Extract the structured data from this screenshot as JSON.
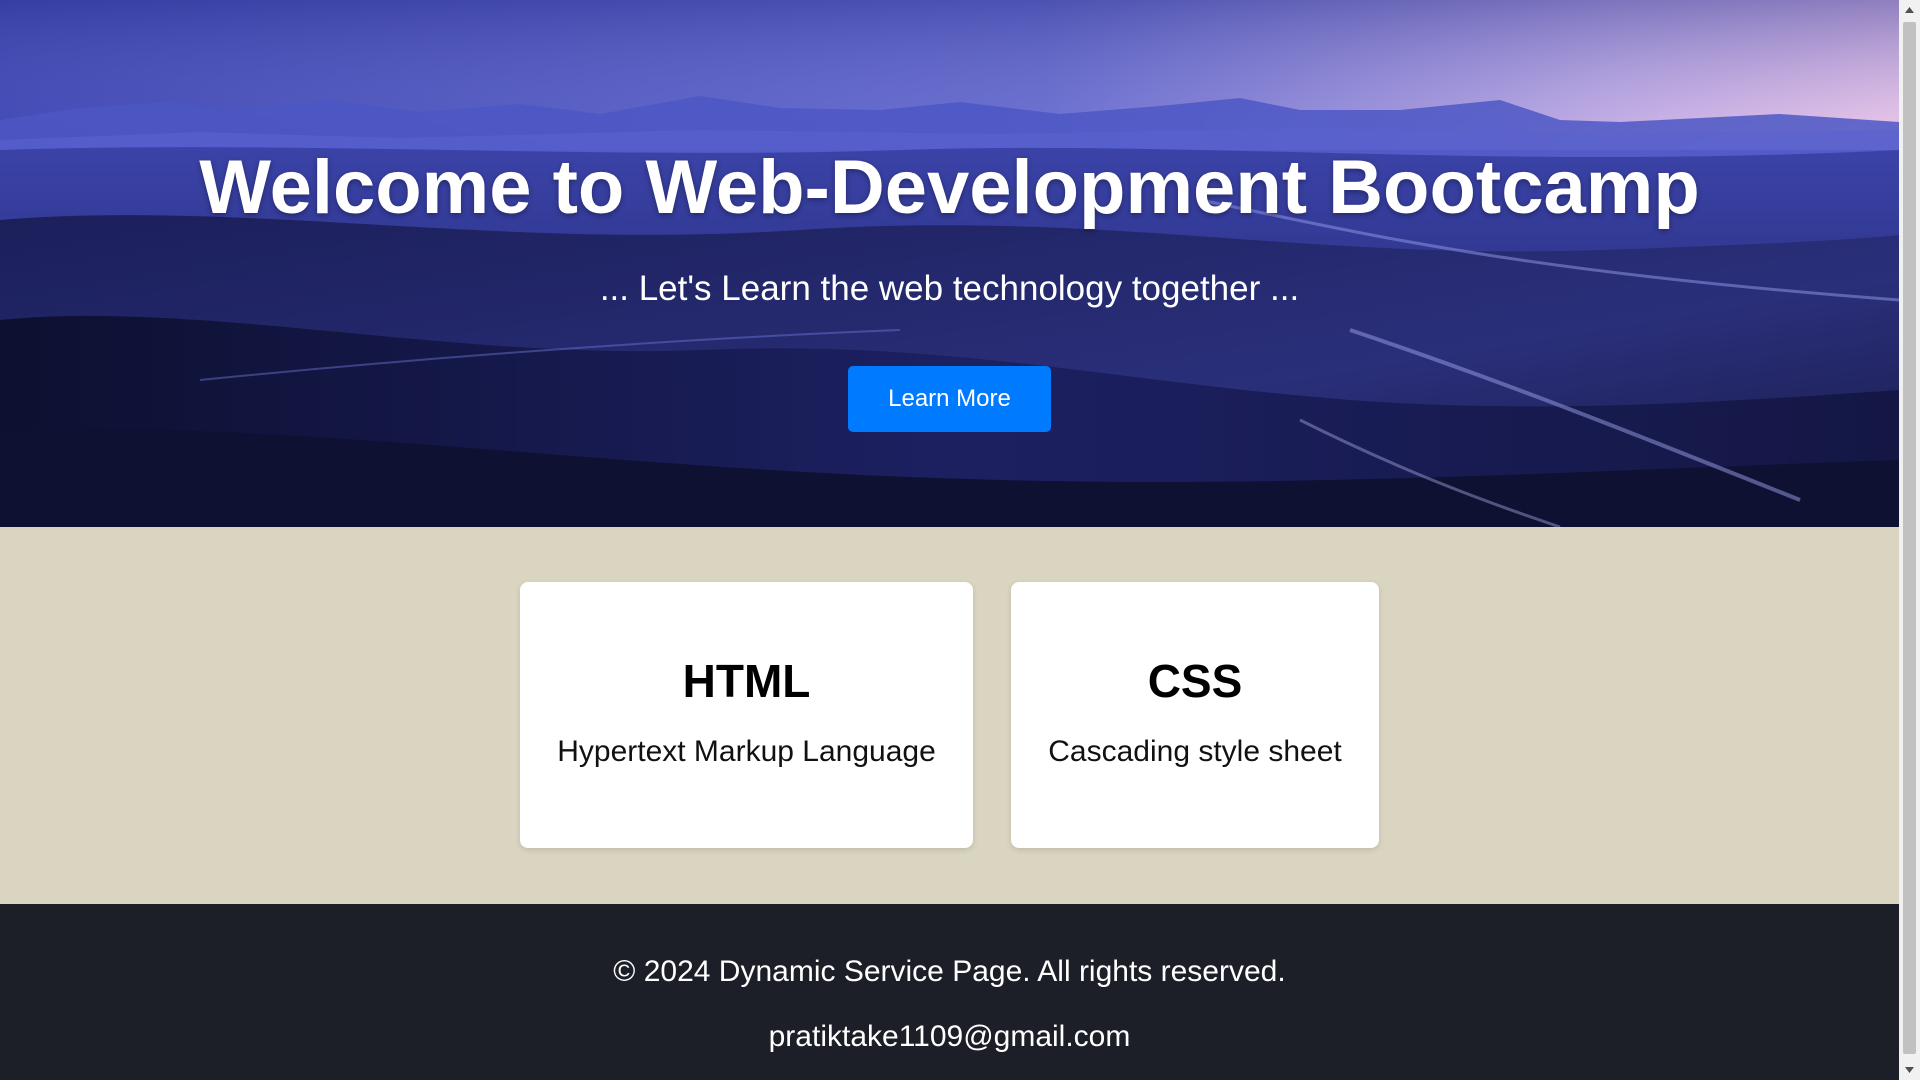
{
  "hero": {
    "title": "Welcome to Web-Development Bootcamp",
    "subtitle": "... Let's Learn the web technology together ...",
    "button_label": "Learn More"
  },
  "services": [
    {
      "title": "HTML",
      "description": "Hypertext Markup Language"
    },
    {
      "title": "CSS",
      "description": "Cascading style sheet"
    }
  ],
  "footer": {
    "copyright": "© 2024 Dynamic Service Page. All rights reserved.",
    "email": "pratiktake1109@gmail.com"
  },
  "colors": {
    "button": "#007bff",
    "services_bg": "#d9d5c1",
    "footer_bg": "#1c1f27",
    "card_bg": "#ffffff"
  },
  "icons": {
    "scroll_up": "triangle-up-icon",
    "scroll_down": "triangle-down-icon"
  }
}
